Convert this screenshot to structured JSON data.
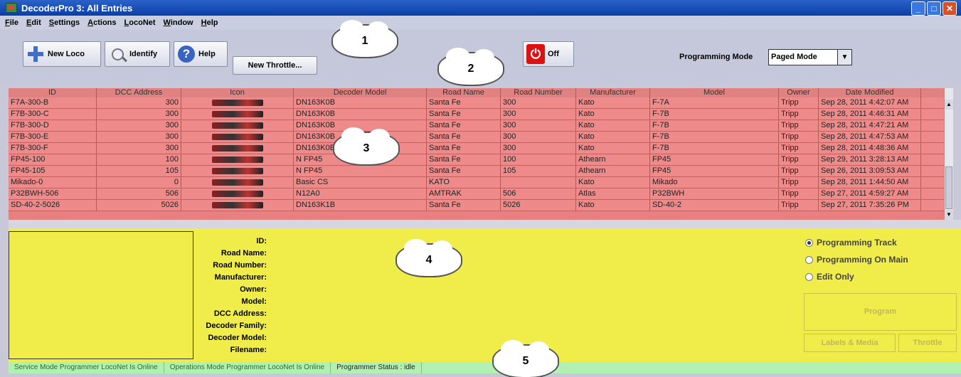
{
  "window": {
    "title": "DecoderPro 3: All Entries"
  },
  "menu": [
    "File",
    "Edit",
    "Settings",
    "Actions",
    "LocoNet",
    "Window",
    "Help"
  ],
  "toolbar": {
    "new_loco": "New Loco",
    "identify": "Identify",
    "help": "Help",
    "new_throttle": "New Throttle...",
    "power": "Off",
    "programming_mode_label": "Programming Mode",
    "programming_mode_value": "Paged Mode"
  },
  "callouts": [
    "1",
    "2",
    "3",
    "4",
    "5"
  ],
  "table": {
    "columns": [
      "ID",
      "DCC Address",
      "Icon",
      "Decoder Model",
      "Road Name",
      "Road Number",
      "Manufacturer",
      "Model",
      "Owner",
      "Date Modified"
    ],
    "rows": [
      [
        "F7A-300-B",
        "300",
        "",
        "DN163K0B",
        "Santa Fe",
        "300",
        "Kato",
        "F-7A",
        "Tripp",
        "Sep 28, 2011 4:42:07 AM"
      ],
      [
        "F7B-300-C",
        "300",
        "",
        "DN163K0B",
        "Santa Fe",
        "300",
        "Kato",
        "F-7B",
        "Tripp",
        "Sep 28, 2011 4:46:31 AM"
      ],
      [
        "F7B-300-D",
        "300",
        "",
        "DN163K0B",
        "Santa Fe",
        "300",
        "Kato",
        "F-7B",
        "Tripp",
        "Sep 28, 2011 4:47:21 AM"
      ],
      [
        "F7B-300-E",
        "300",
        "",
        "DN163K0B",
        "Santa Fe",
        "300",
        "Kato",
        "F-7B",
        "Tripp",
        "Sep 28, 2011 4:47:53 AM"
      ],
      [
        "F7B-300-F",
        "300",
        "",
        "DN163K0B",
        "Santa Fe",
        "300",
        "Kato",
        "F-7B",
        "Tripp",
        "Sep 28, 2011 4:48:36 AM"
      ],
      [
        "FP45-100",
        "100",
        "",
        "N FP45",
        "Santa Fe",
        "100",
        "Athearn",
        "FP45",
        "Tripp",
        "Sep 29, 2011 3:28:13 AM"
      ],
      [
        "FP45-105",
        "105",
        "",
        "N FP45",
        "Santa Fe",
        "105",
        "Athearn",
        "FP45",
        "Tripp",
        "Sep 26, 2011 3:09:53 AM"
      ],
      [
        "Mikado-0",
        "0",
        "",
        "Basic CS",
        "KATO",
        "",
        "Kato",
        "Mikado",
        "Tripp",
        "Sep 28, 2011 1:44:50 AM"
      ],
      [
        "P32BWH-506",
        "506",
        "",
        "N12A0",
        "AMTRAK",
        "506",
        "Atlas",
        "P32BWH",
        "Tripp",
        "Sep 27, 2011 4:59:27 AM"
      ],
      [
        "SD-40-2-5026",
        "5026",
        "",
        "DN163K1B",
        "Santa Fe",
        "5026",
        "Kato",
        "SD-40-2",
        "Tripp",
        "Sep 27, 2011 7:35:26 PM"
      ]
    ]
  },
  "details": {
    "labels": [
      "ID:",
      "Road Name:",
      "Road Number:",
      "Manufacturer:",
      "Owner:",
      "Model:",
      "DCC Address:",
      "Decoder Family:",
      "Decoder Model:",
      "Filename:"
    ]
  },
  "programming": {
    "options": [
      "Programming Track",
      "Programming On Main",
      "Edit Only"
    ],
    "selected": "Programming Track",
    "program_button": "Program",
    "labels_media_button": "Labels & Media",
    "throttle_button": "Throttle"
  },
  "status": {
    "service": "Service Mode Programmer LocoNet Is Online",
    "operations": "Operations Mode Programmer LocoNet Is Online",
    "programmer_status": "Programmer Status :  idle"
  },
  "colors": {
    "table_bg": "#ef8a8a",
    "detail_bg": "#f0ec4a",
    "status_bg": "#b2f0b2"
  }
}
